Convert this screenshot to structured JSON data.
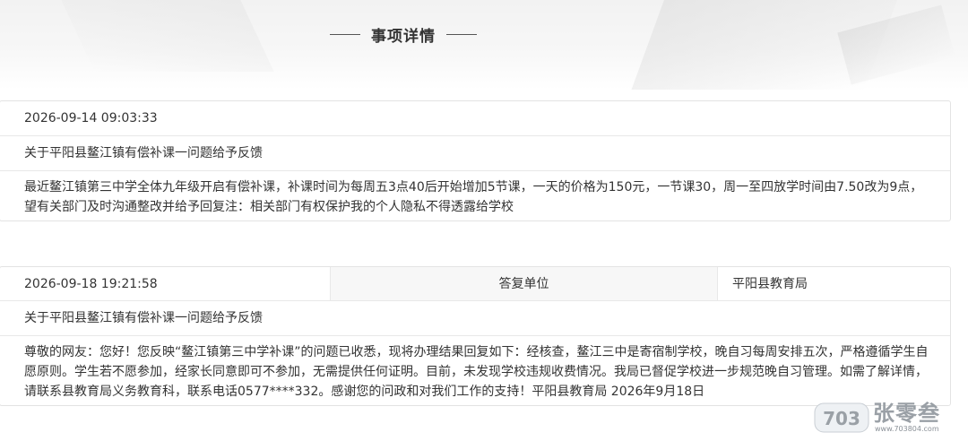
{
  "header": {
    "title": "事项详情"
  },
  "item1": {
    "datetime": "2026-09-14 09:03:33",
    "subject": "关于平阳县鳌江镇有偿补课一问题给予反馈",
    "content": "最近鳌江镇第三中学全体九年级开启有偿补课，补课时间为每周五3点40后开始增加5节课，一天的价格为150元，一节课30，周一至四放学时间由7.50改为9点，望有关部门及时沟通整改并给予回复注：相关部门有权保护我的个人隐私不得透露给学校"
  },
  "reply": {
    "datetime": "2026-09-18 19:21:58",
    "unit_label": "答复单位",
    "unit_value": "平阳县教育局",
    "subject": "关于平阳县鳌江镇有偿补课一问题给予反馈",
    "content": "尊敬的网友：您好！您反映“鳌江镇第三中学补课”的问题已收悉，现将办理结果回复如下：经核查，鳌江三中是寄宿制学校，晚自习每周安排五次，严格遵循学生自愿原则。学生若不愿参加，经家长同意即可不参加，无需提供任何证明。目前，未发现学校违规收费情况。我局已督促学校进一步规范晚自习管理。如需了解详情，请联系县教育局义务教育科，联系电话0577****332。感谢您的问政和对我们工作的支持！平阳县教育局 2026年9月18日"
  },
  "watermark": {
    "badge": "703",
    "name": "张零叁",
    "url": "www.703804.com"
  }
}
